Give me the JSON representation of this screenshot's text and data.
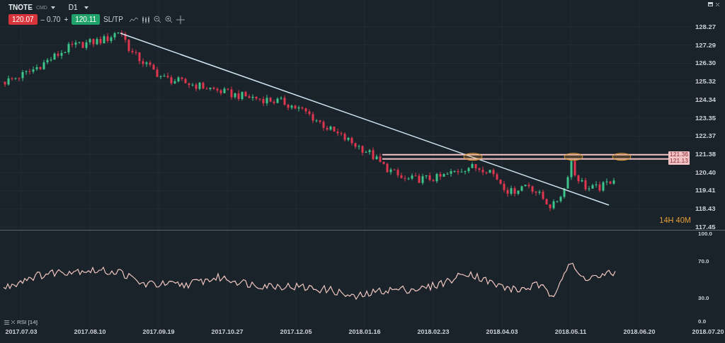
{
  "instrument": {
    "symbol": "TNOTE",
    "type": "CMD",
    "timeframe": "D1"
  },
  "quote": {
    "sell": "120.07",
    "change": "– 0.70",
    "plus": "+",
    "buy": "120.11",
    "sltp": "SL/TP"
  },
  "price_axis": [
    "128.27",
    "127.29",
    "126.30",
    "125.32",
    "124.34",
    "123.35",
    "122.37",
    "121.38",
    "120.40",
    "119.41",
    "118.43",
    "117.45"
  ],
  "levels": {
    "upper": "121.36",
    "lower": "121.13"
  },
  "countdown": "14H 40M",
  "indicator": {
    "label": "RSI [14]",
    "axis": [
      "100.0",
      "70.0",
      "30.0",
      "0.0"
    ]
  },
  "date_axis": [
    "2017.07.03",
    "2017.08.10",
    "2017.09.19",
    "2017.10.27",
    "2017.12.05",
    "2018.01.16",
    "2018.02.23",
    "2018.04.03",
    "2018.05.11",
    "2018.06.20",
    "2018.07.20"
  ]
}
